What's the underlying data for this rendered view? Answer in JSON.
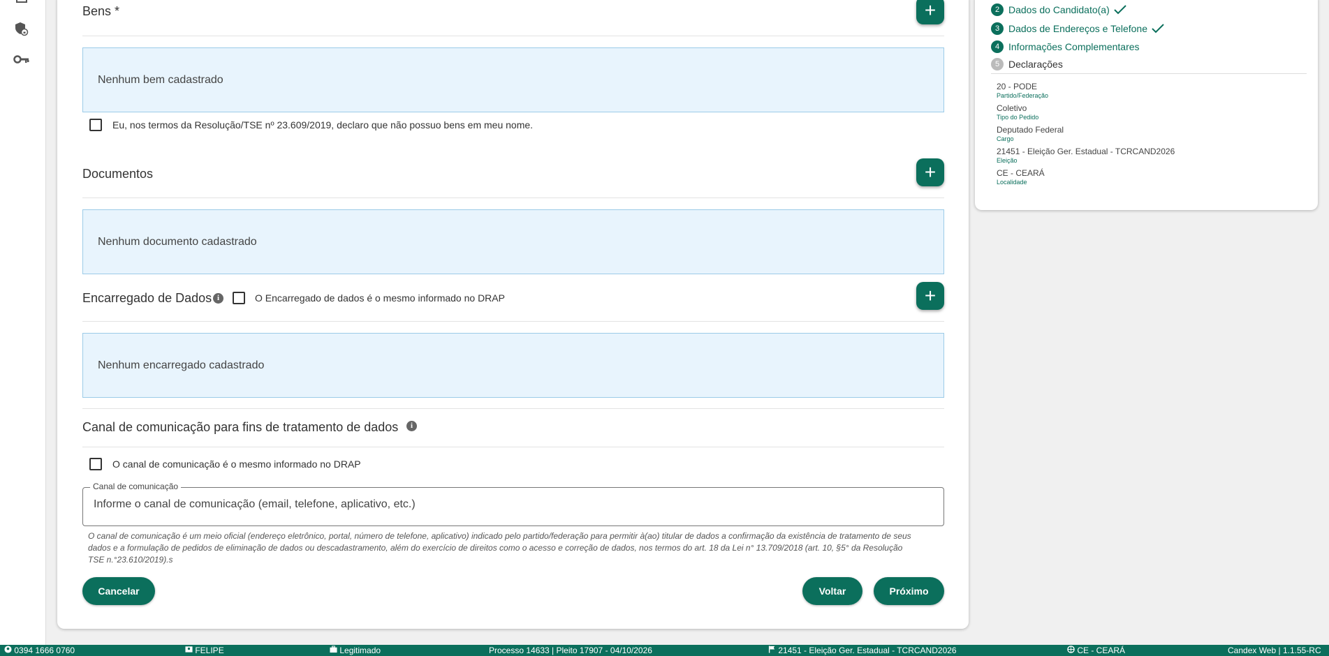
{
  "sidebar": {
    "icons": [
      "layers-icon",
      "shield-lock-icon",
      "key-icon"
    ]
  },
  "bens": {
    "title": "Bens *",
    "empty_text": "Nenhum bem cadastrado",
    "declaration_label": "Eu, nos termos da Resolução/TSE nº 23.609/2019, declaro que não possuo bens em meu nome."
  },
  "documentos": {
    "title": "Documentos",
    "empty_text": "Nenhum documento cadastrado"
  },
  "encarregado": {
    "title": "Encarregado de Dados",
    "checkbox_label": "O Encarregado de dados é o mesmo informado no DRAP",
    "empty_text": "Nenhum encarregado cadastrado"
  },
  "canal": {
    "title": "Canal de comunicação para fins de tratamento de dados",
    "checkbox_label": "O canal de comunicação é o mesmo informado no DRAP",
    "field_label": "Canal de comunicação",
    "field_placeholder": "Informe o canal de comunicação (email, telefone, aplicativo, etc.)",
    "field_value": "",
    "hint": "O canal de comunicação é um meio oficial (endereço eletrônico, portal, número de telefone, aplicativo) indicado pelo partido/federação para permitir à(ao) titular de dados a confirmação da existência de tratamento de seus dados e a formulação de pedidos de eliminação de dados ou descadastramento, além do exercício de direitos como o acesso e correção de dados, nos termos do art. 18 da Lei n° 13.709/2018 (art. 10, §5° da Resolução TSE n.°23.610/2019).s"
  },
  "actions": {
    "cancel": "Cancelar",
    "back": "Voltar",
    "next": "Próximo"
  },
  "add_symbol": "+",
  "info_symbol": "i",
  "steps": [
    {
      "num": "2",
      "label": "Dados do Candidato(a)",
      "done": true
    },
    {
      "num": "3",
      "label": "Dados de Endereços e Telefone",
      "done": true
    },
    {
      "num": "4",
      "label": "Informações Complementares",
      "done": false
    },
    {
      "num": "5",
      "label": "Declarações",
      "done": false
    }
  ],
  "summary": [
    {
      "value": "20 - PODE",
      "label": "Partido/Federação"
    },
    {
      "value": "Coletivo",
      "label": "Tipo do Pedido"
    },
    {
      "value": "Deputado Federal",
      "label": "Cargo"
    },
    {
      "value": "21451 - Eleição Ger. Estadual - TCRCAND2026",
      "label": "Eleição"
    },
    {
      "value": "CE - CEARÁ",
      "label": "Localidade"
    }
  ],
  "footer": {
    "user_id": "0394 1666 0760",
    "user_name": "FELIPE",
    "role": "Legitimado",
    "process": "Processo 14633 | Pleito 17907 - 04/10/2026",
    "election": "21451 - Eleição Ger. Estadual - TCRCAND2026",
    "location": "CE - CEARÁ",
    "version": "Candex Web | 1.1.55-RC"
  },
  "colors": {
    "primary": "#0b6f5c",
    "empty_box_bg": "#e8f4fd",
    "empty_box_border": "#9ccbe8"
  }
}
